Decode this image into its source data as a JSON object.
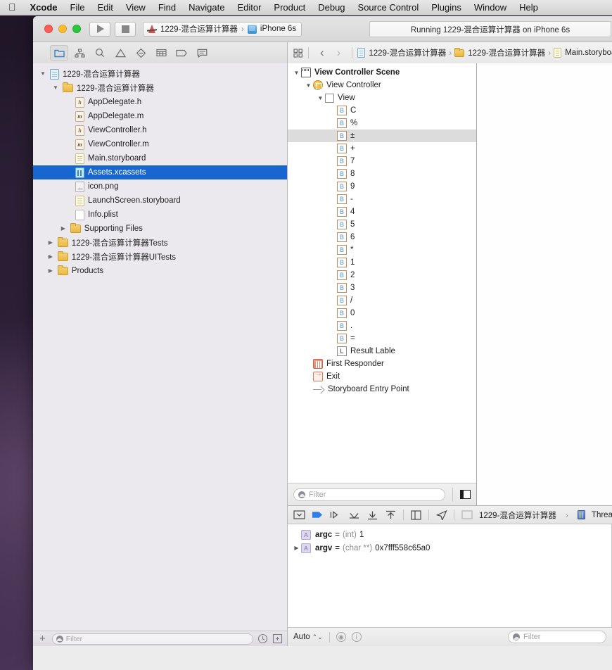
{
  "menubar": {
    "apple": "apple-logo",
    "items": [
      {
        "label": "Xcode",
        "bold": true
      },
      {
        "label": "File",
        "bold": false
      },
      {
        "label": "Edit",
        "bold": false
      },
      {
        "label": "View",
        "bold": false
      },
      {
        "label": "Find",
        "bold": false
      },
      {
        "label": "Navigate",
        "bold": false
      },
      {
        "label": "Editor",
        "bold": false
      },
      {
        "label": "Product",
        "bold": false
      },
      {
        "label": "Debug",
        "bold": false
      },
      {
        "label": "Source Control",
        "bold": false
      },
      {
        "label": "Plugins",
        "bold": false
      },
      {
        "label": "Window",
        "bold": false
      },
      {
        "label": "Help",
        "bold": false
      }
    ]
  },
  "toolbar": {
    "run_label": "Run",
    "stop_label": "Stop",
    "scheme_name": "1229-混合运算计算器",
    "scheme_separator": "›",
    "destination": "iPhone 6s",
    "status": "Running 1229-混合运算计算器 on iPhone 6s"
  },
  "navigator_toolbar": {
    "items": [
      {
        "name": "project-navigator",
        "icon": "folder-icon",
        "active": true
      },
      {
        "name": "source-control-navigator",
        "icon": "source-control-icon",
        "active": false
      },
      {
        "name": "symbol-navigator",
        "icon": "search-icon",
        "active": false
      },
      {
        "name": "issue-navigator",
        "icon": "warning-triangle-icon",
        "active": false
      },
      {
        "name": "test-navigator",
        "icon": "test-diamond-icon",
        "active": false
      },
      {
        "name": "debug-navigator",
        "icon": "debug-grid-icon",
        "active": false
      },
      {
        "name": "breakpoint-navigator",
        "icon": "breakpoint-icon",
        "active": false
      },
      {
        "name": "report-navigator",
        "icon": "report-bubble-icon",
        "active": false
      }
    ]
  },
  "jumpbar": {
    "related_items_label": "Related Items",
    "back_label": "‹",
    "forward_label": "›",
    "crumbs": [
      {
        "label": "1229-混合运算计算器",
        "icon": "project-icon"
      },
      {
        "label": "1229-混合运算计算器",
        "icon": "folder-icon"
      },
      {
        "label": "Main.storyboa",
        "icon": "storyboard-icon"
      }
    ],
    "chevron": "›"
  },
  "navigator": {
    "rows": [
      {
        "label": "1229-混合运算计算器",
        "icon": "project-icon",
        "depth": 0,
        "twisty": "open",
        "selected": false
      },
      {
        "label": "1229-混合运算计算器",
        "icon": "folder-icon",
        "depth": 1,
        "twisty": "open",
        "selected": false
      },
      {
        "label": "AppDelegate.h",
        "icon": "header-file-icon",
        "depth": 2,
        "twisty": "none",
        "selected": false
      },
      {
        "label": "AppDelegate.m",
        "icon": "implementation-file-icon",
        "depth": 2,
        "twisty": "none",
        "selected": false
      },
      {
        "label": "ViewController.h",
        "icon": "header-file-icon",
        "depth": 2,
        "twisty": "none",
        "selected": false
      },
      {
        "label": "ViewController.m",
        "icon": "implementation-file-icon",
        "depth": 2,
        "twisty": "none",
        "selected": false
      },
      {
        "label": "Main.storyboard",
        "icon": "storyboard-icon",
        "depth": 2,
        "twisty": "none",
        "selected": false
      },
      {
        "label": "Assets.xcassets",
        "icon": "assets-catalog-icon",
        "depth": 2,
        "twisty": "none",
        "selected": true
      },
      {
        "label": "icon.png",
        "icon": "image-file-icon",
        "depth": 2,
        "twisty": "none",
        "selected": false
      },
      {
        "label": "LaunchScreen.storyboard",
        "icon": "storyboard-icon",
        "depth": 2,
        "twisty": "none",
        "selected": false
      },
      {
        "label": "Info.plist",
        "icon": "plist-file-icon",
        "depth": 2,
        "twisty": "none",
        "selected": false
      },
      {
        "label": "Supporting Files",
        "icon": "folder-icon",
        "depth": 1.6,
        "twisty": "closed",
        "selected": false
      },
      {
        "label": "1229-混合运算计算器Tests",
        "icon": "folder-icon",
        "depth": 0.6,
        "twisty": "closed",
        "selected": false
      },
      {
        "label": "1229-混合运算计算器UITests",
        "icon": "folder-icon",
        "depth": 0.6,
        "twisty": "closed",
        "selected": false
      },
      {
        "label": "Products",
        "icon": "folder-icon",
        "depth": 0.6,
        "twisty": "closed",
        "selected": false
      }
    ],
    "add_label": "+",
    "filter_placeholder": "Filter",
    "recent_button": "recent-files-icon",
    "sourcecontrol_button": "source-control-filter-icon"
  },
  "outline": {
    "rows": [
      {
        "label": "View Controller Scene",
        "icon": "scene-icon",
        "depth": 0,
        "twisty": "open",
        "bold": true,
        "highlight": false
      },
      {
        "label": "View Controller",
        "icon": "view-controller-icon",
        "depth": 1,
        "twisty": "open",
        "bold": false,
        "highlight": false
      },
      {
        "label": "View",
        "icon": "view-icon",
        "depth": 2,
        "twisty": "open",
        "bold": false,
        "highlight": false
      },
      {
        "label": "C",
        "icon": "button-icon",
        "depth": 3,
        "twisty": "none",
        "bold": false,
        "highlight": false
      },
      {
        "label": "%",
        "icon": "button-icon",
        "depth": 3,
        "twisty": "none",
        "bold": false,
        "highlight": false
      },
      {
        "label": "±",
        "icon": "button-icon",
        "depth": 3,
        "twisty": "none",
        "bold": false,
        "highlight": true
      },
      {
        "label": "+",
        "icon": "button-icon",
        "depth": 3,
        "twisty": "none",
        "bold": false,
        "highlight": false
      },
      {
        "label": "7",
        "icon": "button-icon",
        "depth": 3,
        "twisty": "none",
        "bold": false,
        "highlight": false
      },
      {
        "label": "8",
        "icon": "button-icon",
        "depth": 3,
        "twisty": "none",
        "bold": false,
        "highlight": false
      },
      {
        "label": "9",
        "icon": "button-icon",
        "depth": 3,
        "twisty": "none",
        "bold": false,
        "highlight": false
      },
      {
        "label": "-",
        "icon": "button-icon",
        "depth": 3,
        "twisty": "none",
        "bold": false,
        "highlight": false
      },
      {
        "label": "4",
        "icon": "button-icon",
        "depth": 3,
        "twisty": "none",
        "bold": false,
        "highlight": false
      },
      {
        "label": "5",
        "icon": "button-icon",
        "depth": 3,
        "twisty": "none",
        "bold": false,
        "highlight": false
      },
      {
        "label": "6",
        "icon": "button-icon",
        "depth": 3,
        "twisty": "none",
        "bold": false,
        "highlight": false
      },
      {
        "label": "*",
        "icon": "button-icon",
        "depth": 3,
        "twisty": "none",
        "bold": false,
        "highlight": false
      },
      {
        "label": "1",
        "icon": "button-icon",
        "depth": 3,
        "twisty": "none",
        "bold": false,
        "highlight": false
      },
      {
        "label": "2",
        "icon": "button-icon",
        "depth": 3,
        "twisty": "none",
        "bold": false,
        "highlight": false
      },
      {
        "label": "3",
        "icon": "button-icon",
        "depth": 3,
        "twisty": "none",
        "bold": false,
        "highlight": false
      },
      {
        "label": "/",
        "icon": "button-icon",
        "depth": 3,
        "twisty": "none",
        "bold": false,
        "highlight": false
      },
      {
        "label": "0",
        "icon": "button-icon",
        "depth": 3,
        "twisty": "none",
        "bold": false,
        "highlight": false
      },
      {
        "label": ".",
        "icon": "button-icon",
        "depth": 3,
        "twisty": "none",
        "bold": false,
        "highlight": false
      },
      {
        "label": "=",
        "icon": "button-icon",
        "depth": 3,
        "twisty": "none",
        "bold": false,
        "highlight": false
      },
      {
        "label": "Result Lable",
        "icon": "label-icon",
        "depth": 3,
        "twisty": "none",
        "bold": false,
        "highlight": false
      },
      {
        "label": "First Responder",
        "icon": "first-responder-icon",
        "depth": 1,
        "twisty": "none",
        "bold": false,
        "highlight": false
      },
      {
        "label": "Exit",
        "icon": "exit-icon",
        "depth": 1,
        "twisty": "none",
        "bold": false,
        "highlight": false
      },
      {
        "label": "Storyboard Entry Point",
        "icon": "entry-point-arrow-icon",
        "depth": 1,
        "twisty": "none",
        "bold": false,
        "highlight": false
      }
    ],
    "filter_placeholder": "Filter",
    "dock_button": "toggle-outline-icon"
  },
  "canvas": {
    "entry_arrow": "storyboard-entry-arrow"
  },
  "debugbar": {
    "buttons": [
      {
        "name": "toggle-debug-area-button",
        "icon": "debug-area-icon"
      },
      {
        "name": "continue-button",
        "icon": "continue-icon"
      },
      {
        "name": "step-over-button",
        "icon": "step-over-icon"
      },
      {
        "name": "step-into-button",
        "icon": "step-into-icon"
      },
      {
        "name": "step-out-button",
        "icon": "step-out-icon"
      },
      {
        "name": "view-hierarchy-button",
        "icon": "view-hierarchy-icon"
      },
      {
        "name": "simulate-location-button",
        "icon": "location-arrow-icon"
      }
    ],
    "process_label": "1229-混合运算计算器",
    "separator": "›",
    "thread_label": "Thread"
  },
  "variables": {
    "rows": [
      {
        "name": "argc",
        "eq": "=",
        "type": "(int)",
        "value": "1",
        "twisty": "none",
        "icon": "argument-icon"
      },
      {
        "name": "argv",
        "eq": "=",
        "type": "(char **)",
        "value": "0x7fff558c65a0",
        "twisty": "closed",
        "icon": "argument-icon"
      }
    ]
  },
  "statusbottom": {
    "scope_label": "Auto",
    "scope_stepper": "⌃⌄",
    "eye_icon": "watch-icon",
    "info_icon": "info-icon",
    "filter_placeholder": "Filter"
  },
  "colors": {
    "selection_blue": "#1866d0",
    "highlight_gray": "#dcdcdc",
    "accent_orange": "#e0765a",
    "button_icon_blue": "#4f93cc"
  }
}
